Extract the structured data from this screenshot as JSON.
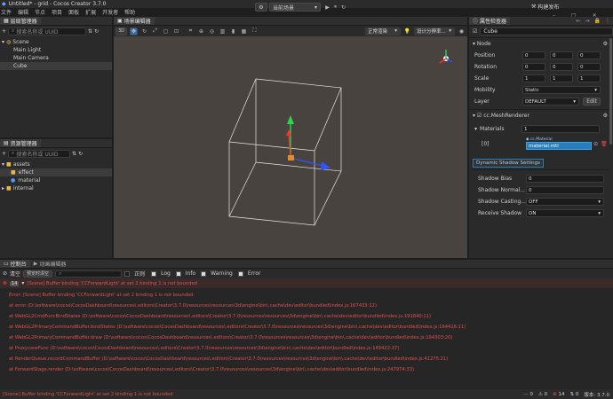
{
  "window": {
    "title": "Untitled* - grid - Cocos Creator 3.7.0"
  },
  "menu": [
    "文件",
    "编辑",
    "节点",
    "项目",
    "面板",
    "扩展",
    "开发者",
    "帮助"
  ],
  "top_toolbar": {
    "scene_mode": "当前场景",
    "build_publish": "构建发布"
  },
  "hierarchy": {
    "title": "层级管理器",
    "search_placeholder": "搜索名称或 UUID",
    "items": [
      {
        "label": "Scene",
        "depth": 0
      },
      {
        "label": "Main Light",
        "depth": 1
      },
      {
        "label": "Main Camera",
        "depth": 1
      },
      {
        "label": "Cube",
        "depth": 1
      }
    ]
  },
  "assets": {
    "title": "资源管理器",
    "search_placeholder": "搜索名称或 UUID",
    "items": [
      {
        "label": "assets",
        "depth": 0,
        "icon": "folder-icon"
      },
      {
        "label": "effect",
        "depth": 1,
        "icon": "effect-icon"
      },
      {
        "label": "material",
        "depth": 1,
        "icon": "material-icon"
      },
      {
        "label": "internal",
        "depth": 0,
        "icon": "folder-icon"
      }
    ]
  },
  "scene": {
    "title": "场景编辑器",
    "mode_3d": "3D",
    "render_mode": "正常渲染",
    "design_resolution": "设计分辨率..."
  },
  "inspector": {
    "title": "属性检查器",
    "node_name": "Cube",
    "node_section": "Node",
    "rows": [
      {
        "label": "Position",
        "values": [
          "0",
          "0",
          "0"
        ]
      },
      {
        "label": "Rotation",
        "values": [
          "0",
          "0",
          "0"
        ]
      },
      {
        "label": "Scale",
        "values": [
          "1",
          "1",
          "1"
        ]
      }
    ],
    "mobility_label": "Mobility",
    "mobility_value": "Static",
    "layer_label": "Layer",
    "layer_value": "DEFAULT",
    "edit_label": "Edit",
    "mesh_renderer": "cc.MeshRenderer",
    "materials_label": "Materials",
    "materials_count": "1",
    "material_index": "[0]",
    "material_type": "cc.Material",
    "material_value": "material.mtl",
    "shadow_tab": "Dynamic Shadow Settings",
    "shadow_bias_label": "Shadow Bias",
    "shadow_bias": "0",
    "shadow_normal_label": "Shadow Normal...",
    "shadow_normal": "0",
    "shadow_casting_label": "Shadow Casting...",
    "shadow_casting": "OFF",
    "receive_shadow_label": "Receive Shadow",
    "receive_shadow": "ON"
  },
  "console": {
    "tab_console": "控制台",
    "tab_anim": "动画编辑器",
    "clear": "清空",
    "clear_preview": "预览时清空",
    "regex": "正则",
    "filters": [
      "Log",
      "Info",
      "Warning",
      "Error"
    ],
    "count": "14",
    "header_msg": "[Scene] Buffer binding 'CCForwardLight' at set 2 binding 1 is not bounded",
    "lines": [
      "Error: [Scene] Buffer binding 'CCForwardLight' at set 2 binding 1 is not bounded",
      "at error (D:\\software\\cocos\\CocosDashboard\\resources\\.editors\\Creator\\3.7.0\\resources\\resources\\3d\\engine\\bin\\.cache\\dev\\editor\\bundled\\index.js:167433:12)",
      "at WebGL2CmdFuncBindStates (D:\\software\\cocos\\CocosDashboard\\resources\\.editors\\Creator\\3.7.0\\resources\\resources\\3d\\engine\\bin\\.cache\\dev\\editor\\bundled\\index.js:191840:11)",
      "at WebGL2PrimaryCommandBuffer.bindStates (D:\\software\\cocos\\CocosDashboard\\resources\\.editors\\Creator\\3.7.0\\resources\\resources\\3d\\engine\\bin\\.cache\\dev\\editor\\bundled\\index.js:194416:11)",
      "at WebGL2PrimaryCommandBuffer.draw (D:\\software\\cocos\\CocosDashboard\\resources\\.editors\\Creator\\3.7.0\\resources\\resources\\3d\\engine\\bin\\.cache\\dev\\editor\\bundled\\index.js:194303:20)",
      "at Proxy.newFunc (D:\\software\\cocos\\CocosDashboard\\resources\\.editors\\Creator\\3.7.0\\resources\\resources\\3d\\engine\\bin\\.cache\\dev\\editor\\bundled\\index.js:149422:37)",
      "at RenderQueue.recordCommandBuffer (D:\\software\\cocos\\CocosDashboard\\resources\\.editors\\Creator\\3.7.0\\resources\\resources\\3d\\engine\\bin\\.cache\\dev\\editor\\bundled\\index.js:41275:21)",
      "at ForwardStage.render (D:\\software\\cocos\\CocosDashboard\\resources\\.editors\\Creator\\3.7.0\\resources\\resources\\3d\\engine\\bin\\.cache\\dev\\editor\\bundled\\index.js:247974:33)"
    ]
  },
  "status": {
    "message": "[Scene] Buffer binding 'CCForwardLight' at set 2 binding 1 is not bounded",
    "c1": "0",
    "c2": "0",
    "c3": "14",
    "c4": "0",
    "version": "版本: 3.7.0"
  }
}
